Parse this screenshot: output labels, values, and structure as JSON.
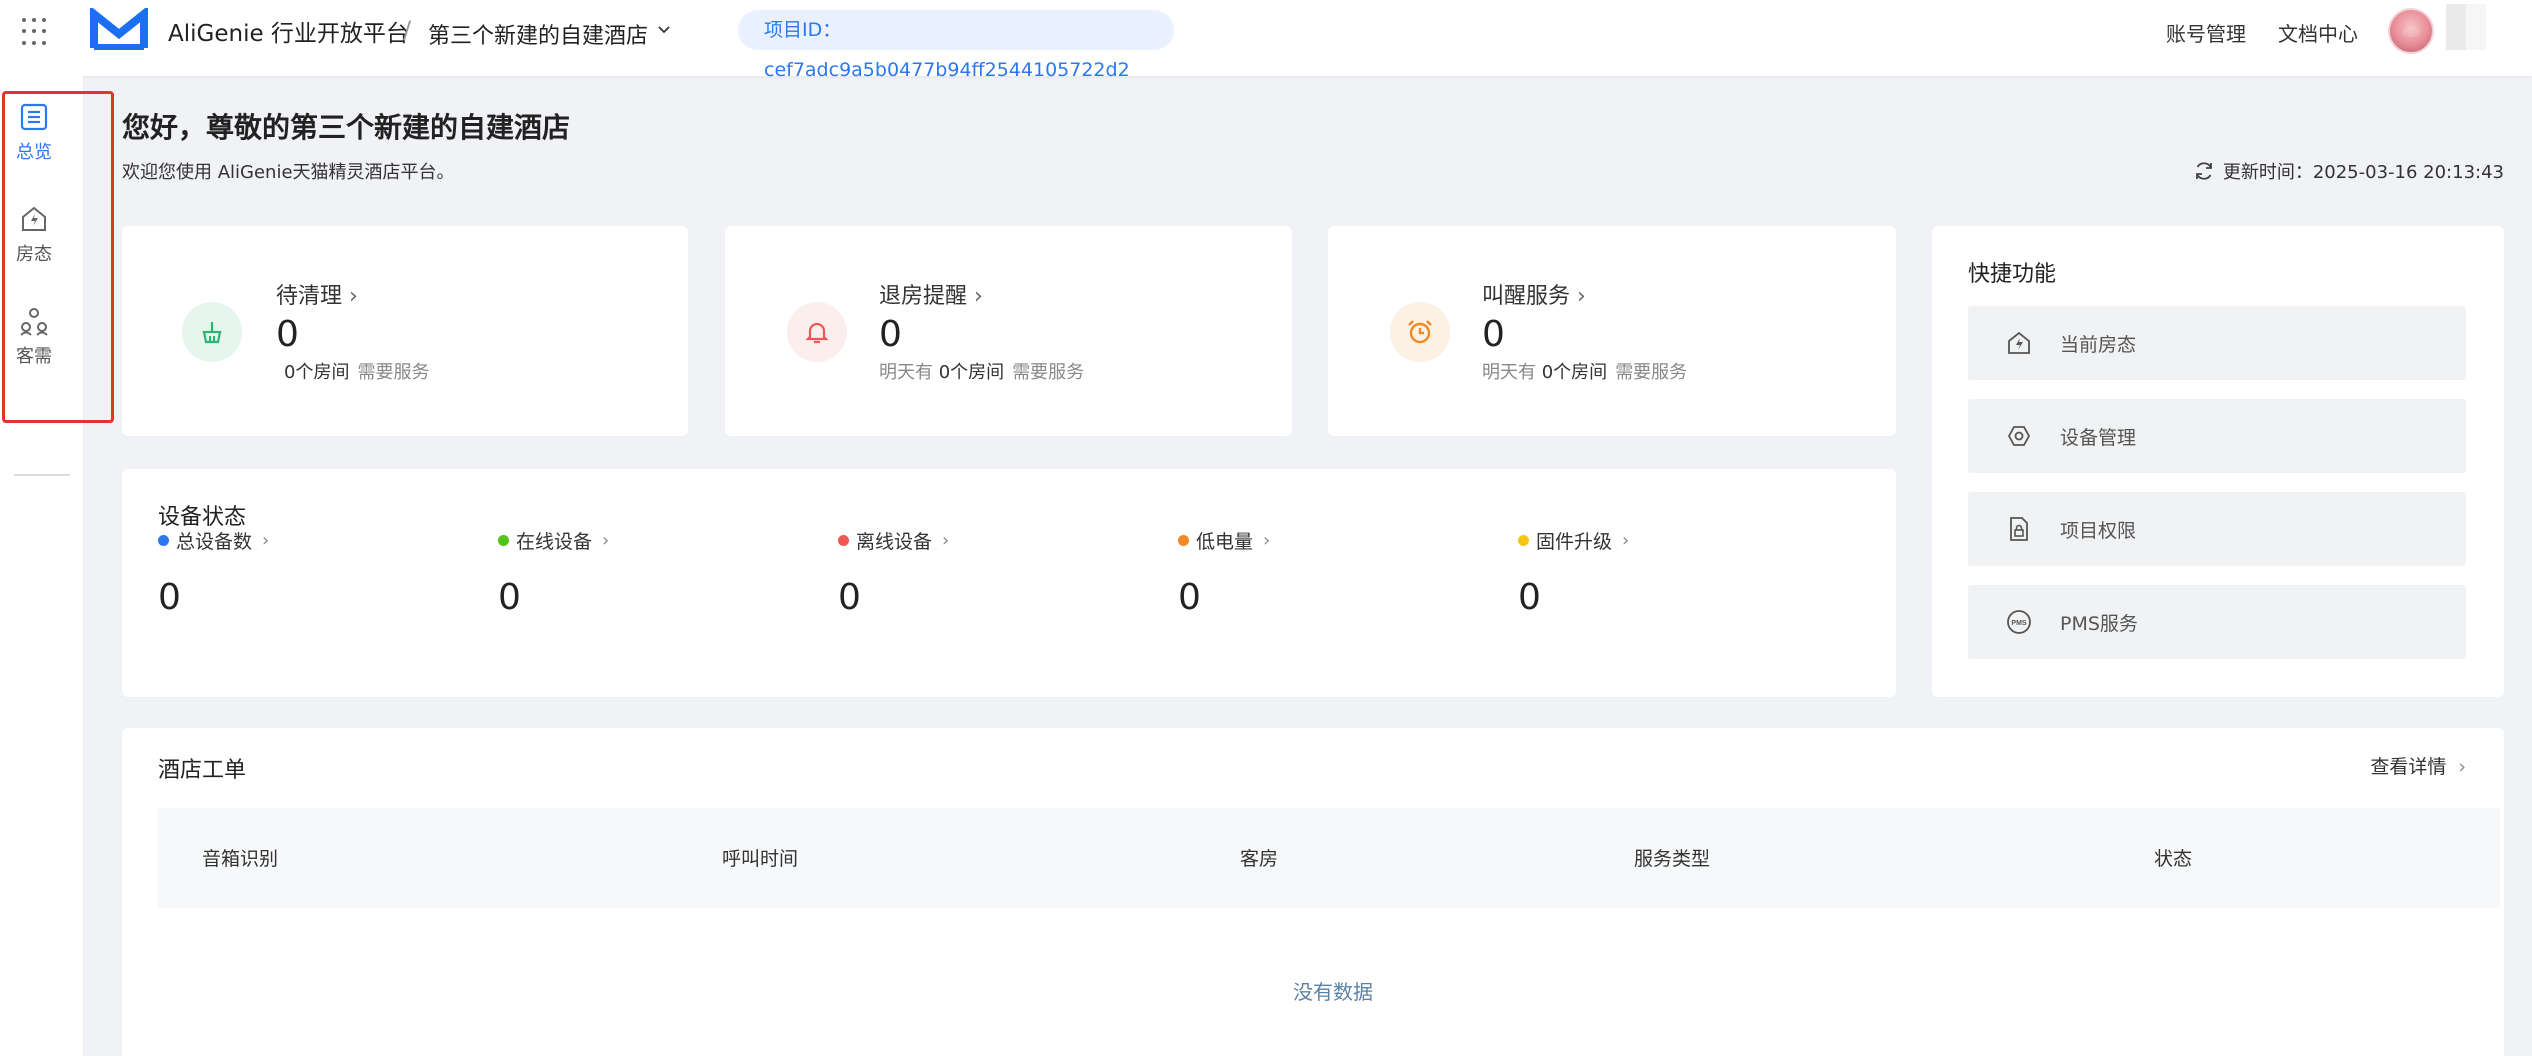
{
  "header": {
    "brand": "AliGenie 行业开放平台",
    "separator": "/",
    "hotel_name": "第三个新建的自建酒店",
    "project_id": "项目ID：cef7adc9a5b0477b94ff2544105722d2",
    "account_link": "账号管理",
    "docs_link": "文档中心"
  },
  "sidebar": {
    "items": [
      {
        "label": "总览",
        "icon": "list-icon"
      },
      {
        "label": "房态",
        "icon": "house-bolt-icon"
      },
      {
        "label": "客需",
        "icon": "people-icon"
      }
    ]
  },
  "main": {
    "greeting": "您好，尊敬的第三个新建的自建酒店",
    "welcome": "欢迎您使用 AliGenie天猫精灵酒店平台。",
    "update_time": "更新时间：2025-03-16 20:13:43"
  },
  "stats": [
    {
      "title": "待清理",
      "value": "0",
      "prefix": "",
      "rooms": "0个房间",
      "suffix": "需要服务",
      "icon": "broom-icon",
      "color": "#2bb673"
    },
    {
      "title": "退房提醒",
      "value": "0",
      "prefix": "明天有",
      "rooms": "0个房间",
      "suffix": "需要服务",
      "icon": "bell-icon",
      "color": "#f05656"
    },
    {
      "title": "叫醒服务",
      "value": "0",
      "prefix": "明天有",
      "rooms": "0个房间",
      "suffix": "需要服务",
      "icon": "alarm-clock-icon",
      "color": "#f08a24"
    }
  ],
  "devices": {
    "title": "设备状态",
    "items": [
      {
        "label": "总设备数",
        "value": "0",
        "color": "#2b78f0"
      },
      {
        "label": "在线设备",
        "value": "0",
        "color": "#52c41a"
      },
      {
        "label": "离线设备",
        "value": "0",
        "color": "#f05656"
      },
      {
        "label": "低电量",
        "value": "0",
        "color": "#f08a24"
      },
      {
        "label": "固件升级",
        "value": "0",
        "color": "#f5c518"
      }
    ]
  },
  "quick": {
    "title": "快捷功能",
    "items": [
      {
        "label": "当前房态",
        "icon": "house-bolt-icon"
      },
      {
        "label": "设备管理",
        "icon": "hexagon-gear-icon"
      },
      {
        "label": "项目权限",
        "icon": "document-lock-icon"
      },
      {
        "label": "PMS服务",
        "icon": "pms-icon"
      }
    ]
  },
  "orders": {
    "title": "酒店工单",
    "more": "查看详情",
    "columns": [
      "音箱识别",
      "呼叫时间",
      "客房",
      "服务类型",
      "状态"
    ],
    "empty": "没有数据"
  }
}
